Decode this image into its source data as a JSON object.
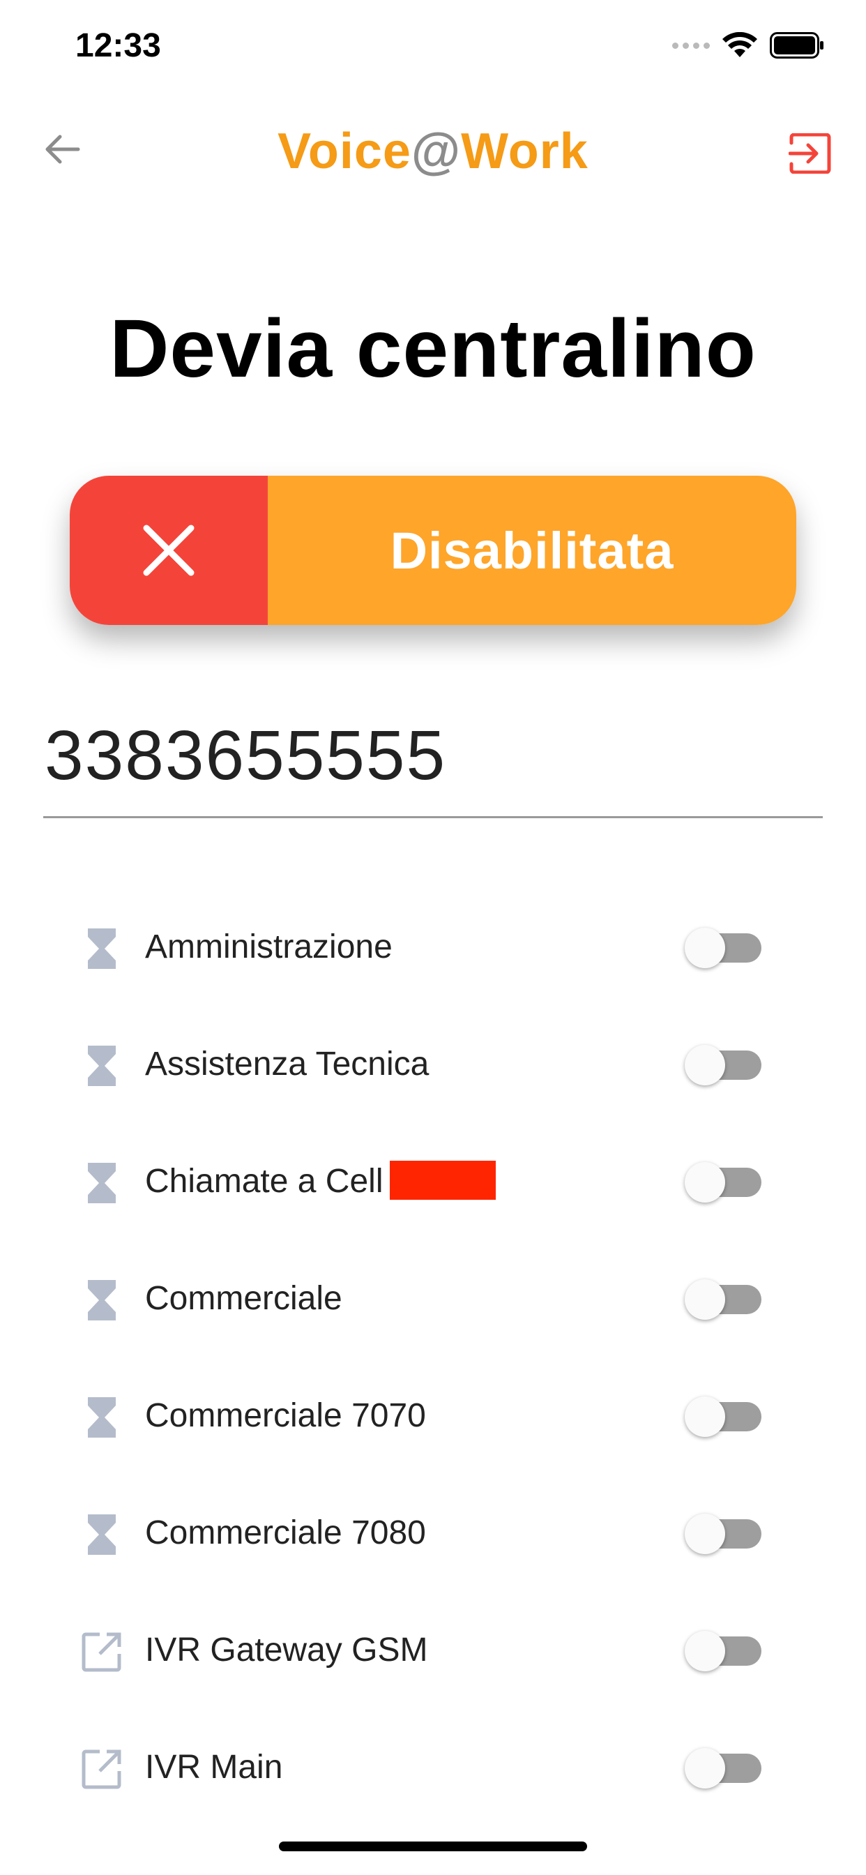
{
  "status_bar": {
    "time": "12:33",
    "icons": [
      "signal-dots-icon",
      "wifi-icon",
      "battery-icon"
    ]
  },
  "header": {
    "title_part1": "Voice",
    "title_at": "@",
    "title_part2": "Work",
    "back_icon": "arrow-left-icon",
    "logout_icon": "logout-icon"
  },
  "page": {
    "title": "Devia centralino"
  },
  "forward_toggle": {
    "status_label": "Disabilitata",
    "icon": "close-icon",
    "colors": {
      "icon_bg": "#f4443a",
      "label_bg": "#fea52a"
    }
  },
  "number_field": {
    "value": "3383655555"
  },
  "groups": [
    {
      "name": "Amministrazione",
      "icon": "hourglass-icon",
      "enabled": false
    },
    {
      "name": "Assistenza Tecnica",
      "icon": "hourglass-icon",
      "enabled": false
    },
    {
      "name": "Chiamate a Cell",
      "icon": "hourglass-icon",
      "enabled": false,
      "redacted": true
    },
    {
      "name": "Commerciale",
      "icon": "hourglass-icon",
      "enabled": false
    },
    {
      "name": "Commerciale 7070",
      "icon": "hourglass-icon",
      "enabled": false
    },
    {
      "name": "Commerciale 7080",
      "icon": "hourglass-icon",
      "enabled": false
    },
    {
      "name": "IVR Gateway GSM",
      "icon": "external-link-icon",
      "enabled": false
    },
    {
      "name": "IVR Main",
      "icon": "external-link-icon",
      "enabled": false
    }
  ],
  "colors": {
    "brand_orange": "#f59b16",
    "logout_red": "#f4443a",
    "icon_gray": "#b4bccb"
  }
}
